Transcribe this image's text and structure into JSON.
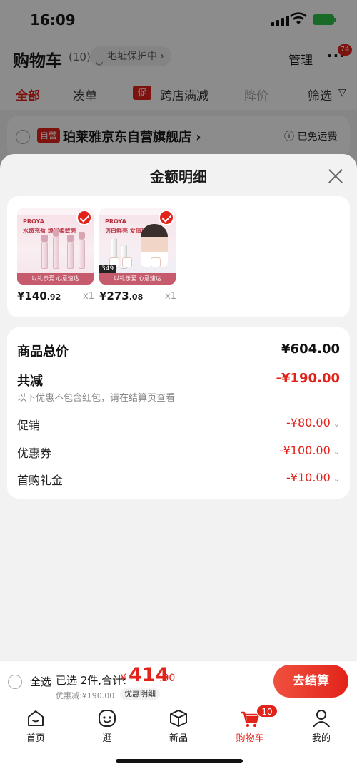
{
  "status": {
    "time": "16:09"
  },
  "header": {
    "title": "购物车",
    "count": "(10)",
    "address_protect": "地址保护中 ›",
    "manage": "管理",
    "more": "···",
    "badge": "74"
  },
  "filters": [
    {
      "label": "全部"
    },
    {
      "label": "凑单"
    },
    {
      "label": "跨店满减",
      "tag": "促"
    },
    {
      "label": "降价"
    },
    {
      "label": "筛选"
    }
  ],
  "store": {
    "tag": "自营",
    "name": "珀莱雅京东自营旗舰店 ›",
    "shipping": "已免运费"
  },
  "sheet": {
    "title": "金额明细",
    "products": [
      {
        "brand": "PROYA",
        "headline": "水嫩充盈 焕现柔致亮",
        "banner": "以礼示爱 心意速达",
        "price_int": "¥140",
        "price_dec": ".92",
        "qty": "x1"
      },
      {
        "brand": "PROYA",
        "headline": "透白鲜亮 爱值璀璨新",
        "banner": "以礼示爱 心意速达",
        "tag": "349",
        "price_int": "¥273",
        "price_dec": ".08",
        "qty": "x1"
      }
    ],
    "summary": {
      "subtotal_label": "商品总价",
      "subtotal_value": "¥604.00",
      "reduce_label": "共减",
      "reduce_value": "-¥190.00",
      "note": "以下优惠不包含红包，请在结算页查看",
      "rows": [
        {
          "label": "促销",
          "value": "-¥80.00"
        },
        {
          "label": "优惠券",
          "value": "-¥100.00"
        },
        {
          "label": "首购礼金",
          "value": "-¥10.00"
        }
      ]
    }
  },
  "checkout": {
    "select_all": "全选",
    "selected": "已选 2件,合计:",
    "currency": "¥",
    "total_int": "414",
    "total_dec": ".00",
    "discount": "优惠减:¥190.00",
    "detail": "优惠明细",
    "button": "去结算"
  },
  "tabs": [
    {
      "label": "首页",
      "icon": "home-icon"
    },
    {
      "label": "逛",
      "icon": "face-icon"
    },
    {
      "label": "新品",
      "icon": "box-icon"
    },
    {
      "label": "购物车",
      "icon": "cart-icon",
      "badge": "10"
    },
    {
      "label": "我的",
      "icon": "user-icon"
    }
  ],
  "colors": {
    "accent": "#e2231a",
    "overlay": "rgba(0,0,0,0.45)"
  }
}
